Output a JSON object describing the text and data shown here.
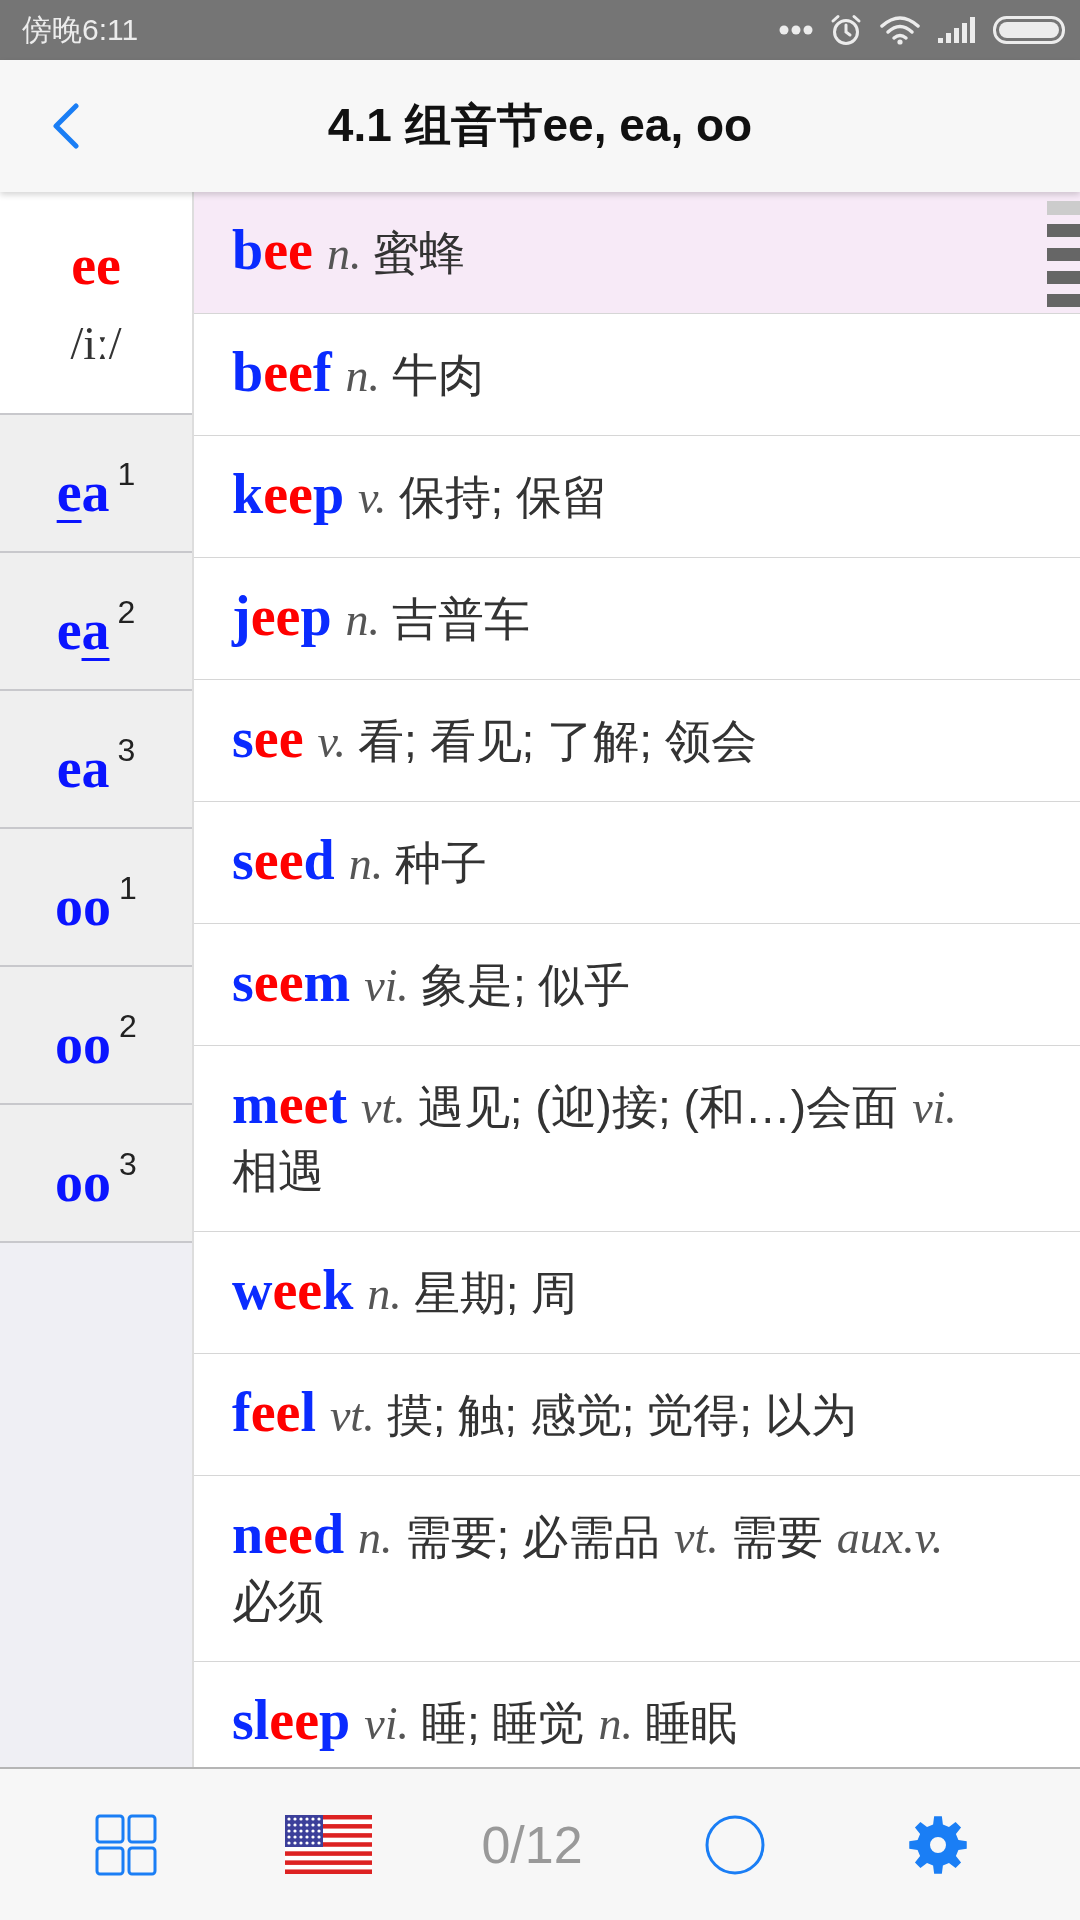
{
  "status_bar": {
    "time": "傍晚6:11"
  },
  "header": {
    "title": "4.1 组音节ee, ea, oo"
  },
  "sidebar": {
    "items": [
      {
        "letters": [
          {
            "text": "ee",
            "underlined": false
          }
        ],
        "phonetic": "/iː/",
        "selected": true
      },
      {
        "letters": [
          {
            "text": "e",
            "underlined": true
          },
          {
            "text": "a",
            "underlined": false
          }
        ],
        "index": "1",
        "selected": false
      },
      {
        "letters": [
          {
            "text": "e",
            "underlined": false
          },
          {
            "text": "a",
            "underlined": true
          }
        ],
        "index": "2",
        "selected": false
      },
      {
        "letters": [
          {
            "text": "ea",
            "underlined": false
          }
        ],
        "index": "3",
        "selected": false
      },
      {
        "letters": [
          {
            "text": "oo",
            "underlined": false
          }
        ],
        "index": "1",
        "selected": false
      },
      {
        "letters": [
          {
            "text": "oo",
            "underlined": false
          }
        ],
        "index": "2",
        "selected": false
      },
      {
        "letters": [
          {
            "text": "oo",
            "underlined": false
          }
        ],
        "index": "3",
        "selected": false
      }
    ]
  },
  "words": [
    {
      "parts": [
        {
          "text": "b",
          "highlighted": false
        },
        {
          "text": "ee",
          "highlighted": true
        }
      ],
      "senses": [
        {
          "pos": "n.",
          "meaning": "蜜蜂"
        }
      ],
      "selected": true
    },
    {
      "parts": [
        {
          "text": "b",
          "highlighted": false
        },
        {
          "text": "ee",
          "highlighted": true
        },
        {
          "text": "f",
          "highlighted": false
        }
      ],
      "senses": [
        {
          "pos": "n.",
          "meaning": "牛肉"
        }
      ],
      "selected": false
    },
    {
      "parts": [
        {
          "text": "k",
          "highlighted": false
        },
        {
          "text": "ee",
          "highlighted": true
        },
        {
          "text": "p",
          "highlighted": false
        }
      ],
      "senses": [
        {
          "pos": "v.",
          "meaning": "保持; 保留"
        }
      ],
      "selected": false
    },
    {
      "parts": [
        {
          "text": "j",
          "highlighted": false
        },
        {
          "text": "ee",
          "highlighted": true
        },
        {
          "text": "p",
          "highlighted": false
        }
      ],
      "senses": [
        {
          "pos": "n.",
          "meaning": "吉普车"
        }
      ],
      "selected": false
    },
    {
      "parts": [
        {
          "text": "s",
          "highlighted": false
        },
        {
          "text": "ee",
          "highlighted": true
        }
      ],
      "senses": [
        {
          "pos": "v.",
          "meaning": "看; 看见; 了解; 领会"
        }
      ],
      "selected": false
    },
    {
      "parts": [
        {
          "text": "s",
          "highlighted": false
        },
        {
          "text": "ee",
          "highlighted": true
        },
        {
          "text": "d",
          "highlighted": false
        }
      ],
      "senses": [
        {
          "pos": "n.",
          "meaning": "种子"
        }
      ],
      "selected": false
    },
    {
      "parts": [
        {
          "text": "s",
          "highlighted": false
        },
        {
          "text": "ee",
          "highlighted": true
        },
        {
          "text": "m",
          "highlighted": false
        }
      ],
      "senses": [
        {
          "pos": "vi.",
          "meaning": "象是; 似乎"
        }
      ],
      "selected": false
    },
    {
      "parts": [
        {
          "text": "m",
          "highlighted": false
        },
        {
          "text": "ee",
          "highlighted": true
        },
        {
          "text": "t",
          "highlighted": false
        }
      ],
      "senses": [
        {
          "pos": "vt.",
          "meaning": "遇见; (迎)接; (和…)会面"
        },
        {
          "pos": "vi.",
          "meaning": "相遇"
        }
      ],
      "selected": false
    },
    {
      "parts": [
        {
          "text": "w",
          "highlighted": false
        },
        {
          "text": "ee",
          "highlighted": true
        },
        {
          "text": "k",
          "highlighted": false
        }
      ],
      "senses": [
        {
          "pos": "n.",
          "meaning": "星期; 周"
        }
      ],
      "selected": false
    },
    {
      "parts": [
        {
          "text": "f",
          "highlighted": false
        },
        {
          "text": "ee",
          "highlighted": true
        },
        {
          "text": "l",
          "highlighted": false
        }
      ],
      "senses": [
        {
          "pos": "vt.",
          "meaning": "摸; 触; 感觉; 觉得; 以为"
        }
      ],
      "selected": false
    },
    {
      "parts": [
        {
          "text": "n",
          "highlighted": false
        },
        {
          "text": "ee",
          "highlighted": true
        },
        {
          "text": "d",
          "highlighted": false
        }
      ],
      "senses": [
        {
          "pos": "n.",
          "meaning": "需要; 必需品"
        },
        {
          "pos": "vt.",
          "meaning": "需要"
        },
        {
          "pos": "aux.v.",
          "meaning": "必须"
        }
      ],
      "selected": false
    },
    {
      "parts": [
        {
          "text": "sl",
          "highlighted": false
        },
        {
          "text": "ee",
          "highlighted": true
        },
        {
          "text": "p",
          "highlighted": false
        }
      ],
      "senses": [
        {
          "pos": "vi.",
          "meaning": "睡; 睡觉"
        },
        {
          "pos": "n.",
          "meaning": "睡眠"
        }
      ],
      "selected": false
    }
  ],
  "bottom_bar": {
    "counter": "0/12"
  }
}
